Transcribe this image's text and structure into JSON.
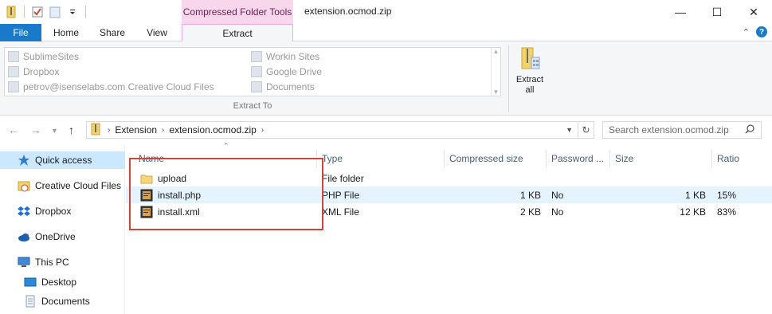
{
  "window": {
    "title": "extension.ocmod.zip",
    "contextual_tab_title": "Compressed Folder Tools",
    "controls": {
      "minimize": "—",
      "maximize": "☐",
      "close": "✕"
    }
  },
  "ribbon": {
    "tabs": [
      "File",
      "Home",
      "Share",
      "View",
      "Extract"
    ],
    "gallery_left": [
      "SublimeSites",
      "Dropbox",
      "petrov@isenselabs.com Creative Cloud Files"
    ],
    "gallery_right": [
      "Workin Sites",
      "Google Drive",
      "Documents"
    ],
    "group_label": "Extract To",
    "extract_all": "Extract all"
  },
  "address": {
    "crumbs": [
      "Extension",
      "extension.ocmod.zip"
    ],
    "search_placeholder": "Search extension.ocmod.zip"
  },
  "nav": {
    "items": [
      "Quick access",
      "Creative Cloud Files",
      "Dropbox",
      "OneDrive",
      "This PC",
      "Desktop",
      "Documents"
    ]
  },
  "columns": [
    "Name",
    "Type",
    "Compressed size",
    "Password ...",
    "Size",
    "Ratio"
  ],
  "files": [
    {
      "name": "upload",
      "type": "File folder",
      "compressed": "",
      "password": "",
      "size": "",
      "ratio": ""
    },
    {
      "name": "install.php",
      "type": "PHP File",
      "compressed": "1 KB",
      "password": "No",
      "size": "1 KB",
      "ratio": "15%"
    },
    {
      "name": "install.xml",
      "type": "XML File",
      "compressed": "2 KB",
      "password": "No",
      "size": "12 KB",
      "ratio": "83%"
    }
  ],
  "colors": {
    "accent": "#1979ca",
    "context_tab": "#f8d7ec",
    "highlight_box": "#d0453a",
    "selection": "#cce8ff"
  }
}
